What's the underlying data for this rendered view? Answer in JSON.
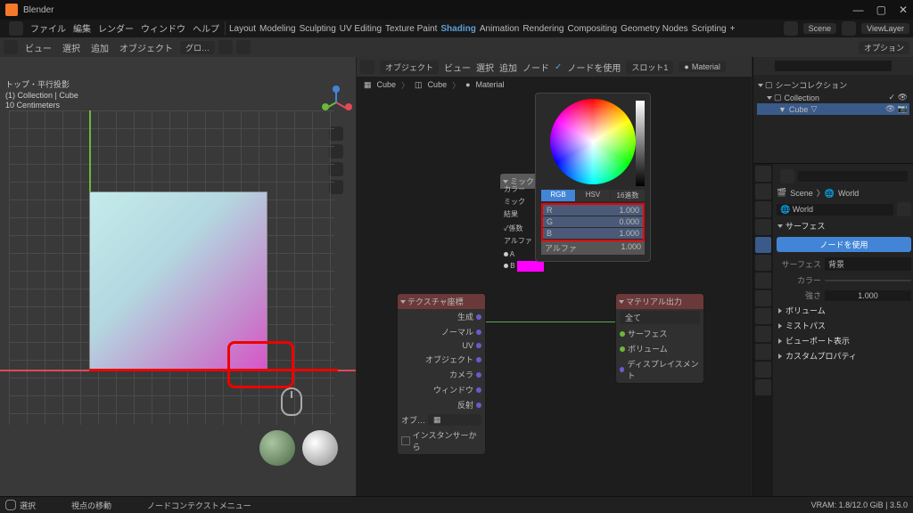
{
  "app": {
    "title": "Blender"
  },
  "menu": {
    "file": "ファイル",
    "edit": "編集",
    "render": "レンダー",
    "window": "ウィンドウ",
    "help": "ヘルプ",
    "workspaces": [
      "Layout",
      "Modeling",
      "Sculpting",
      "UV Editing",
      "Texture Paint",
      "Shading",
      "Animation",
      "Rendering",
      "Compositing",
      "Geometry Nodes",
      "Scripting"
    ],
    "active_ws": "Shading",
    "scene_label": "Scene",
    "viewlayer_label": "ViewLayer"
  },
  "toolbar": {
    "view": "ビュー",
    "select": "選択",
    "add": "追加",
    "object": "オブジェクト",
    "globalmode": "グロ…"
  },
  "viewport": {
    "option": "オプション",
    "top_label": "トップ・平行投影",
    "collection": "(1) Collection | Cube",
    "units": "10 Centimeters"
  },
  "nodeed": {
    "mode": "オブジェクト",
    "view": "ビュー",
    "select": "選択",
    "add": "追加",
    "node": "ノード",
    "use_nodes": "ノードを使用",
    "slot": "スロット1",
    "material": "Material",
    "bc_cube": "Cube",
    "bc_cube2": "Cube",
    "bc_mat": "Material"
  },
  "picker": {
    "tabs": [
      "RGB",
      "HSV",
      "16進数"
    ],
    "active": "RGB",
    "rows": [
      {
        "l": "R",
        "v": "1.000"
      },
      {
        "l": "G",
        "v": "0.000"
      },
      {
        "l": "B",
        "v": "1.000"
      }
    ],
    "side_labels": [
      "カラー",
      "ミック",
      "結果"
    ],
    "factor": "係数",
    "alpha": "アルファ",
    "a": "A",
    "b": "B",
    "alpha_v": "1.000"
  },
  "node_mix": {
    "title": "ミックス",
    "factor": "係数"
  },
  "node_tex": {
    "title": "テクスチャ座標",
    "rows": [
      "生成",
      "ノーマル",
      "UV",
      "オブジェクト",
      "カメラ",
      "ウィンドウ",
      "反射"
    ],
    "obj": "オブ…",
    "inst": "インスタンサーから"
  },
  "node_out": {
    "title": "マテリアル出力",
    "all": "全て",
    "rows": [
      "サーフェス",
      "ボリューム",
      "ディスプレイスメント"
    ]
  },
  "outliner": {
    "scene_coll": "シーンコレクション",
    "collection": "Collection",
    "cube": "Cube",
    "search_placeholder": ""
  },
  "props": {
    "scene": "Scene",
    "world": "World",
    "world2": "World",
    "surface": "サーフェス",
    "use_nodes": "ノードを使用",
    "surf_lab": "サーフェス",
    "surf_val": "背景",
    "color_lab": "カラー",
    "strength_lab": "強さ",
    "strength_val": "1.000",
    "panels": [
      "ボリューム",
      "ミストパス",
      "ビューポート表示",
      "カスタムプロパティ"
    ]
  },
  "status": {
    "select": "選択",
    "move": "視点の移動",
    "ctx": "ノードコンテクストメニュー",
    "vram": "VRAM: 1.8/12.0 GiB | 3.5.0"
  }
}
